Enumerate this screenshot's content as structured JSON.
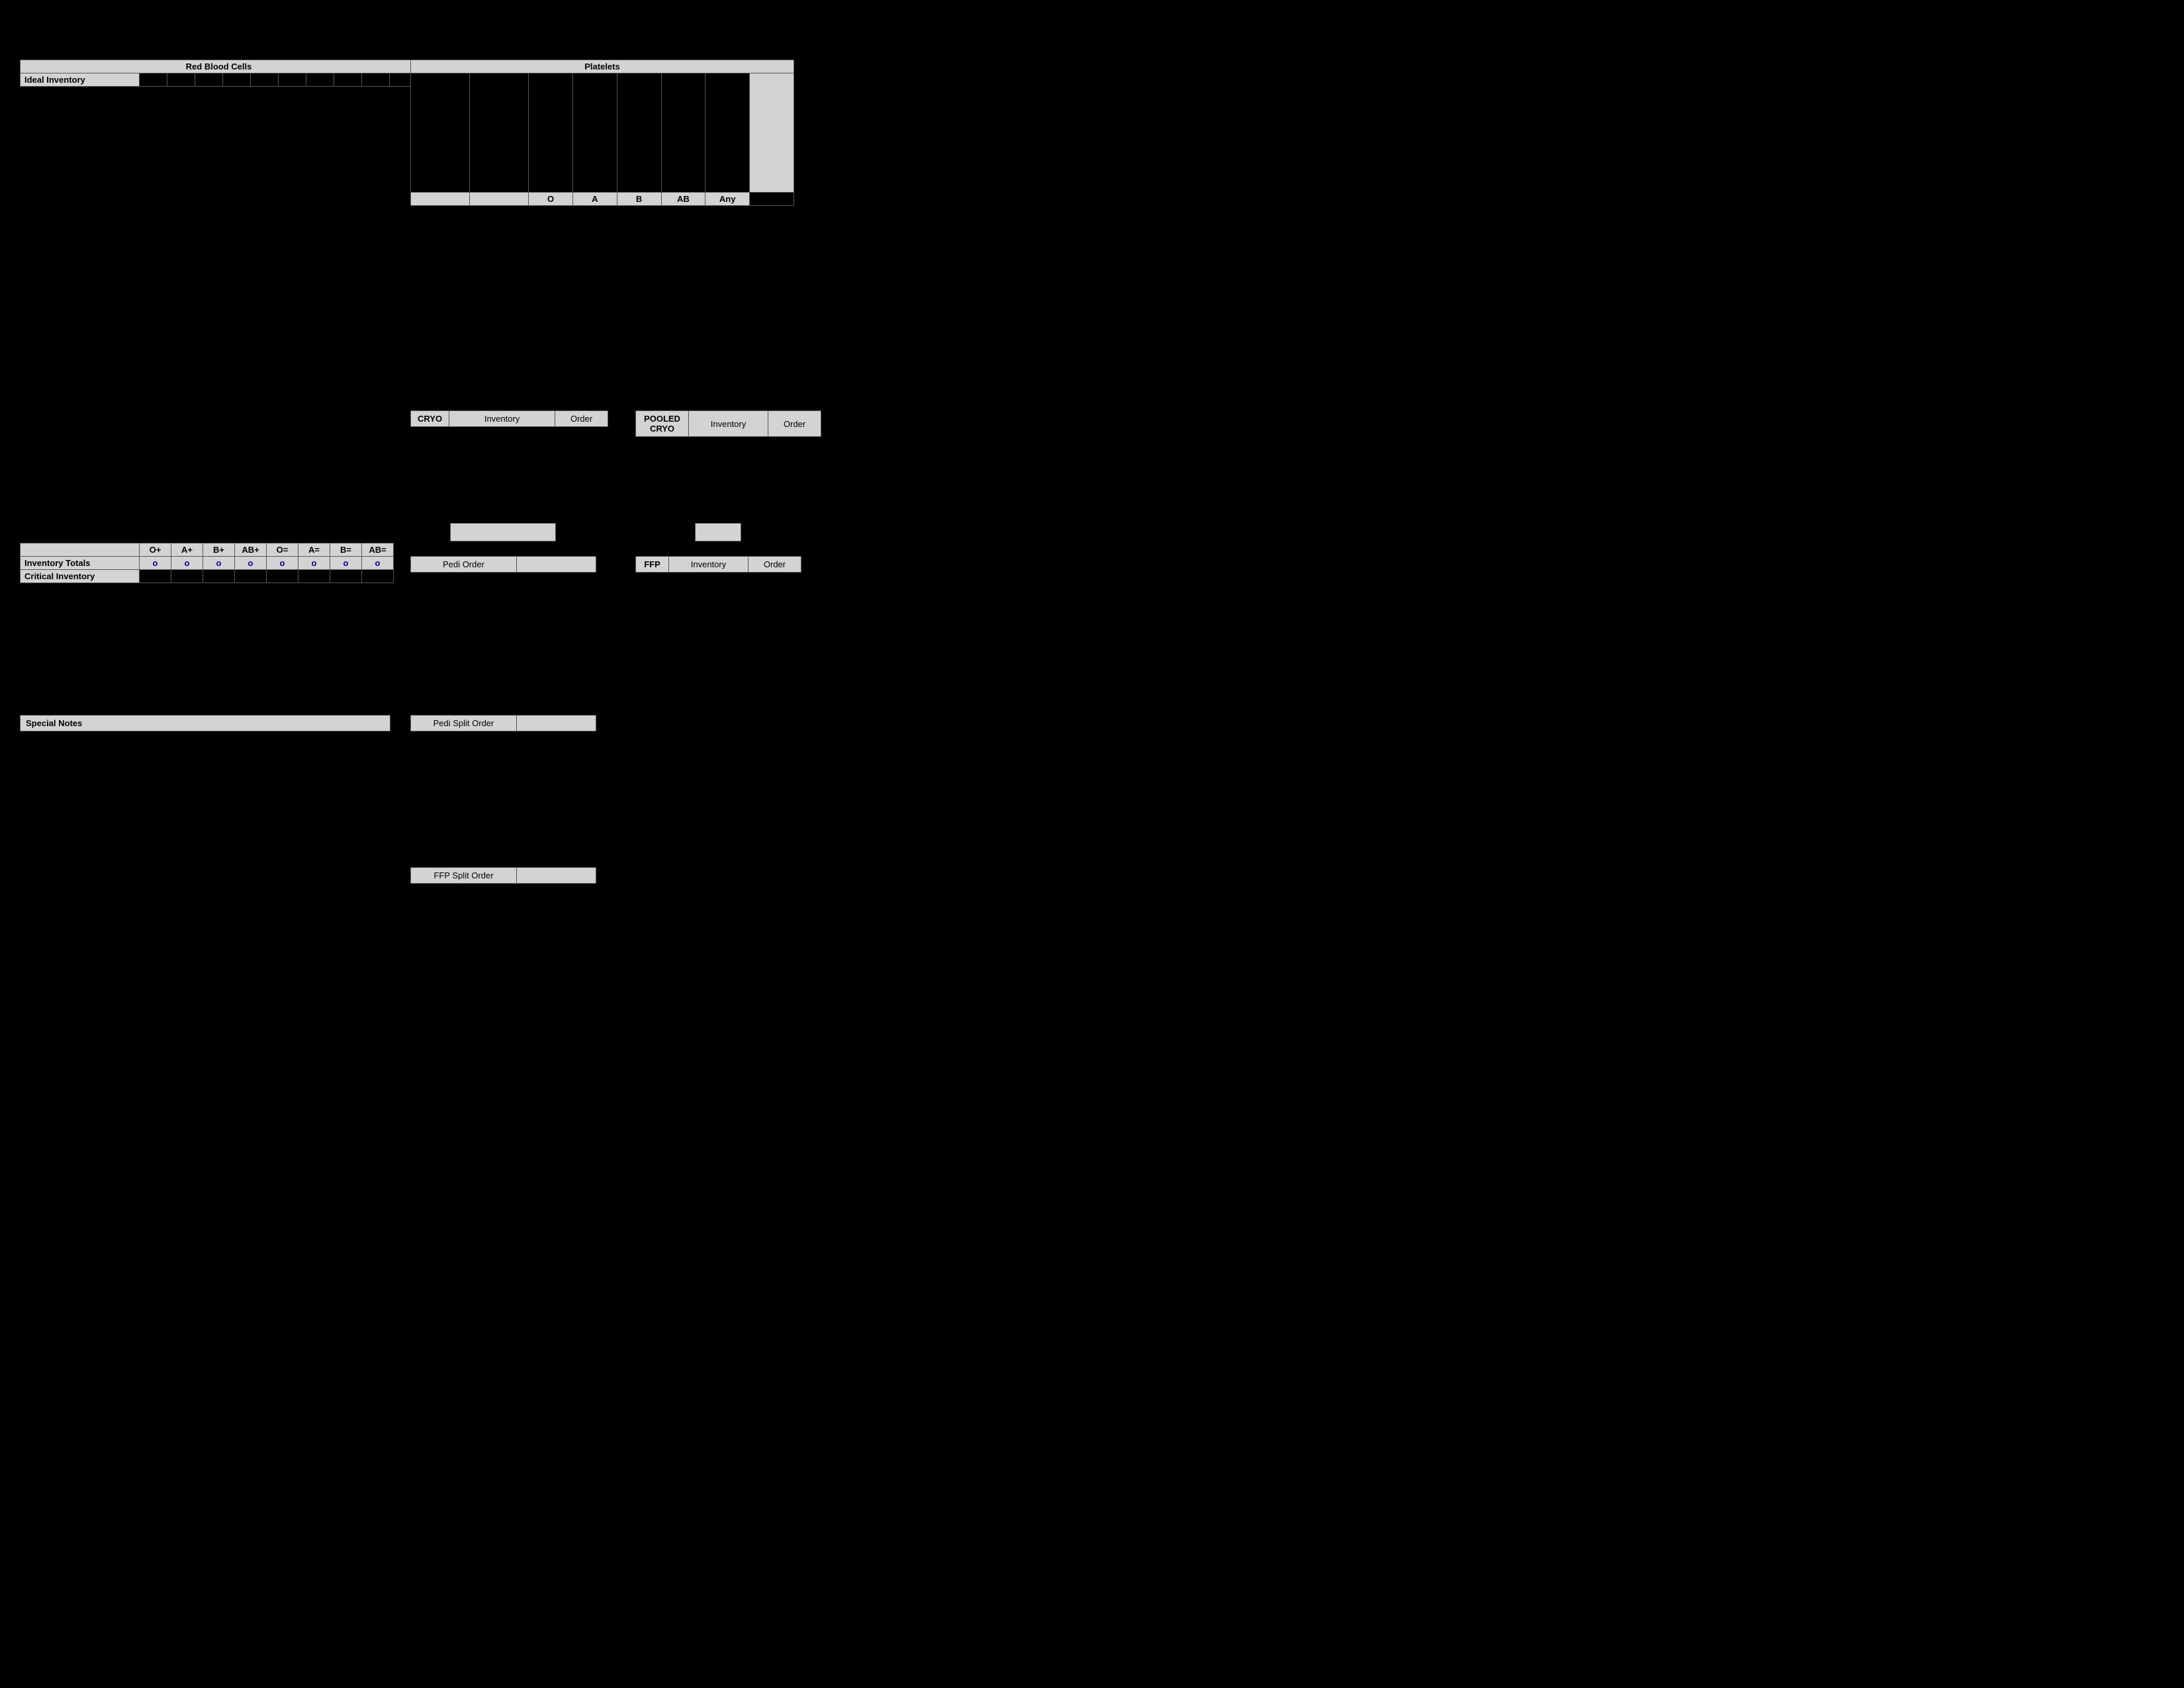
{
  "rbc": {
    "title": "Red Blood Cells",
    "row1_label": "Ideal Inventory",
    "columns": [
      "",
      "",
      "",
      "",
      "",
      "",
      "",
      "",
      "",
      ""
    ],
    "inventory_totals_label": "Inventory Totals",
    "critical_inventory_label": "Critical Inventory",
    "cols_header": [
      "O+",
      "A+",
      "B+",
      "AB+",
      "O=",
      "A=",
      "B=",
      "AB="
    ],
    "totals_values": [
      "o",
      "o",
      "o",
      "o",
      "o",
      "o",
      "o",
      "o"
    ],
    "critical_values": [
      "",
      "",
      "",
      "",
      "",
      "",
      "",
      ""
    ]
  },
  "platelets": {
    "title": "Platelets",
    "bottom_cols": [
      "O",
      "A",
      "B",
      "AB",
      "Any"
    ]
  },
  "cryo": {
    "label": "CRYO",
    "inventory_label": "Inventory",
    "order_label": "Order"
  },
  "pooled_cryo": {
    "label": "POOLED CRYO",
    "inventory_label": "Inventory",
    "order_label": "Order"
  },
  "pedi_order": {
    "label": "Pedi Order",
    "value": ""
  },
  "ffp": {
    "label": "FFP",
    "inventory_label": "Inventory",
    "order_label": "Order",
    "top_value": ""
  },
  "pedi_split_order": {
    "label": "Pedi Split Order",
    "value": ""
  },
  "ffp_split_order": {
    "label": "FFP Split Order",
    "value": ""
  },
  "special_notes": {
    "label": "Special Notes"
  },
  "pedi_top_value": "",
  "ffp_top_value": ""
}
